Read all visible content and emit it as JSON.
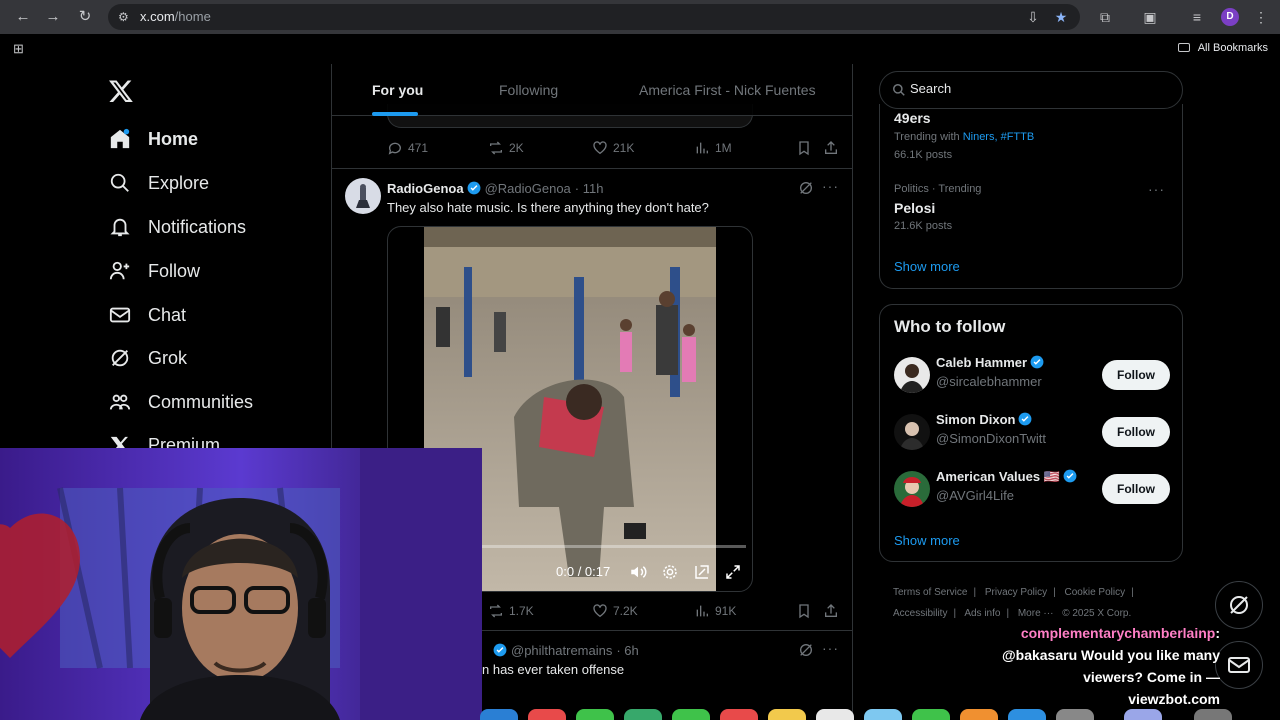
{
  "browser": {
    "url_host": "x.com",
    "url_path": "/home",
    "profile_initial": "D",
    "all_bookmarks_label": "All Bookmarks"
  },
  "nav": {
    "items": [
      {
        "label": "Home",
        "icon": "home-icon",
        "active": true
      },
      {
        "label": "Explore",
        "icon": "search-icon"
      },
      {
        "label": "Notifications",
        "icon": "bell-icon"
      },
      {
        "label": "Follow",
        "icon": "person-plus-icon"
      },
      {
        "label": "Chat",
        "icon": "mail-icon"
      },
      {
        "label": "Grok",
        "icon": "grok-icon"
      },
      {
        "label": "Communities",
        "icon": "people-icon"
      },
      {
        "label": "Premium",
        "icon": "x-logo-icon"
      }
    ]
  },
  "timeline": {
    "tabs": [
      {
        "label": "For you",
        "active": true
      },
      {
        "label": "Following"
      },
      {
        "label": "America First - Nick Fuentes"
      }
    ],
    "prev_tweet": {
      "replies": "471",
      "reposts": "2K",
      "likes": "21K",
      "views": "1M"
    },
    "tweet": {
      "name": "RadioGenoa",
      "handle": "@RadioGenoa",
      "time": "· 11h",
      "text": "They also hate music. Is there anything they don't hate?",
      "video_time": "0:0",
      "video_duration": "/ 0:17",
      "video_progress": 0.12,
      "reposts": "1.7K",
      "likes": "7.2K",
      "views": "91K"
    },
    "next_tweet": {
      "handle": "@philthatremains",
      "time": "· 6h",
      "text": "n has ever taken offense"
    }
  },
  "sidebar": {
    "search_placeholder": "Search",
    "trends": [
      {
        "name": "49ers",
        "meta_prefix": "Trending with",
        "meta_links": "Niners, #FTTB",
        "posts": "66.1K posts"
      },
      {
        "meta": "Politics · Trending",
        "name": "Pelosi",
        "posts": "21.6K posts"
      }
    ],
    "show_more": "Show more",
    "who_to_follow": {
      "title": "Who to follow",
      "users": [
        {
          "name": "Caleb Hammer",
          "handle": "@sircalebhammer",
          "button": "Follow"
        },
        {
          "name": "Simon Dixon",
          "handle": "@SimonDixonTwitt",
          "button": "Follow"
        },
        {
          "name": "American Values",
          "flag": "🇺🇸",
          "handle": "@AVGirl4Life",
          "button": "Follow"
        }
      ],
      "show_more": "Show more"
    },
    "footer": [
      "Terms of Service",
      "|",
      "Privacy Policy",
      "|",
      "Cookie Policy",
      "|",
      "Accessibility",
      "|",
      "Ads info",
      "|",
      "More ···",
      "© 2025 X Corp."
    ]
  },
  "chat_overlay": {
    "user": "complementarychamberlainp",
    "colon": ":",
    "message": "@bakasaru Would you like many viewers? Come in — viewzbot.com"
  },
  "colors": {
    "accent": "#1d9bf0",
    "background": "#000000",
    "chat_user": "#ff7fc6"
  }
}
